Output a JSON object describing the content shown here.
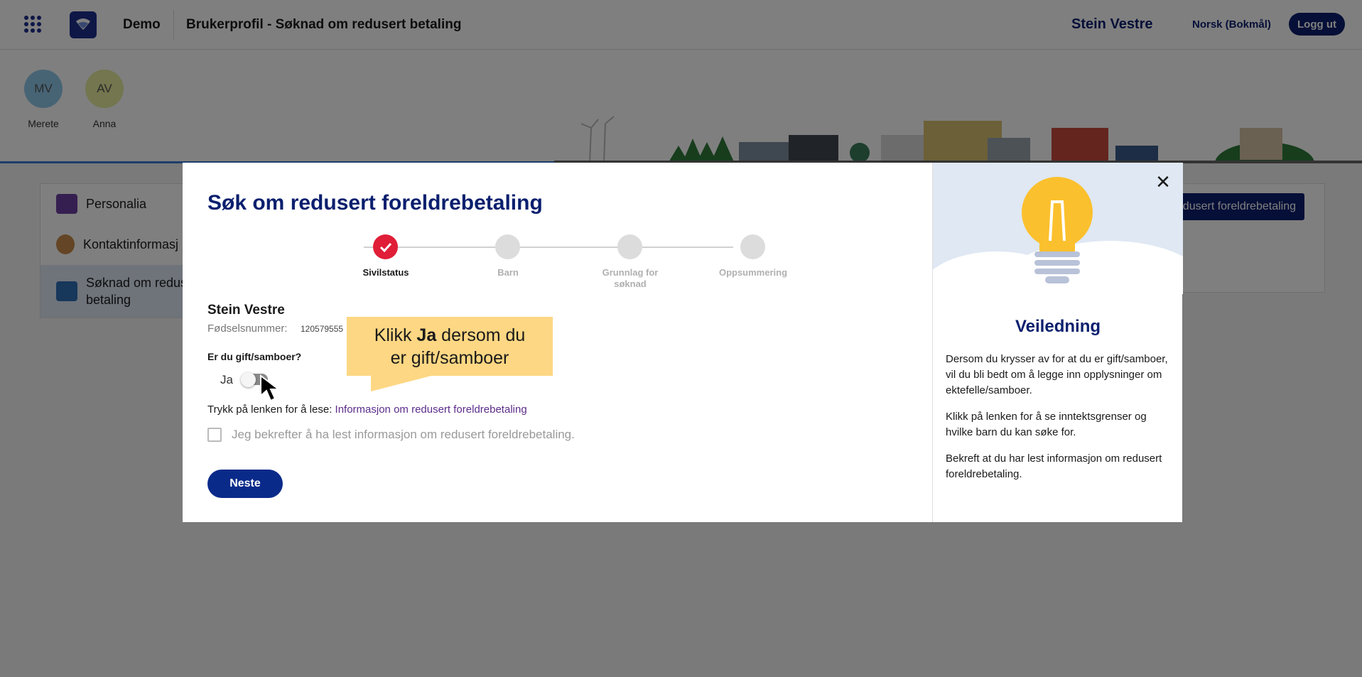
{
  "header": {
    "org_name": "Demo",
    "page_title": "Brukerprofil - Søknad om redusert betaling",
    "user_name": "Stein Vestre",
    "language": "Norsk (Bokmål)",
    "logout_label": "Logg ut"
  },
  "children": [
    {
      "initials": "MV",
      "name": "Merete",
      "color": "#8ec8ea"
    },
    {
      "initials": "AV",
      "name": "Anna",
      "color": "#e6ec9c"
    }
  ],
  "background": {
    "menu": [
      {
        "label": "Personalia"
      },
      {
        "label": "Kontaktinformasj"
      },
      {
        "label_line1": "Søknad om redus",
        "label_line2": "betaling"
      }
    ],
    "panel_button": "edusert foreldrebetaling"
  },
  "modal": {
    "title": "Søk om redusert foreldrebetaling",
    "steps": [
      {
        "label": "Sivilstatus",
        "state": "done"
      },
      {
        "label": "Barn",
        "state": "todo"
      },
      {
        "label_line1": "Grunnlag for",
        "label_line2": "søknad",
        "state": "todo"
      },
      {
        "label": "Oppsummering",
        "state": "todo"
      }
    ],
    "person_name": "Stein Vestre",
    "ssn_label": "Fødselsnummer:",
    "ssn_value": "120579555",
    "question": "Er du gift/samboer?",
    "toggle_label": "Ja",
    "toggle_on": false,
    "link_prefix": "Trykk på lenken for å lese: ",
    "link_text": "Informasjon om redusert foreldrebetaling",
    "confirm_label": "Jeg bekrefter å ha lest informasjon om redusert foreldrebetaling.",
    "next_label": "Neste",
    "callout_prefix": "Klikk ",
    "callout_bold": "Ja",
    "callout_suffix": " dersom du",
    "callout_line2": "er gift/samboer"
  },
  "guide": {
    "title": "Veiledning",
    "paragraphs": [
      "Dersom du krysser av for at du er gift/samboer, vil du bli bedt om å legge inn opplysninger om ektefelle/samboer.",
      "Klikk på lenken for å se inntektsgrenser og hvilke barn du kan søke for.",
      "Bekreft at du har lest informasjon om redusert foreldrebetaling."
    ]
  },
  "colors": {
    "brand": "#0a1f6e",
    "step_done": "#e01e37",
    "callout": "#fdd783"
  }
}
